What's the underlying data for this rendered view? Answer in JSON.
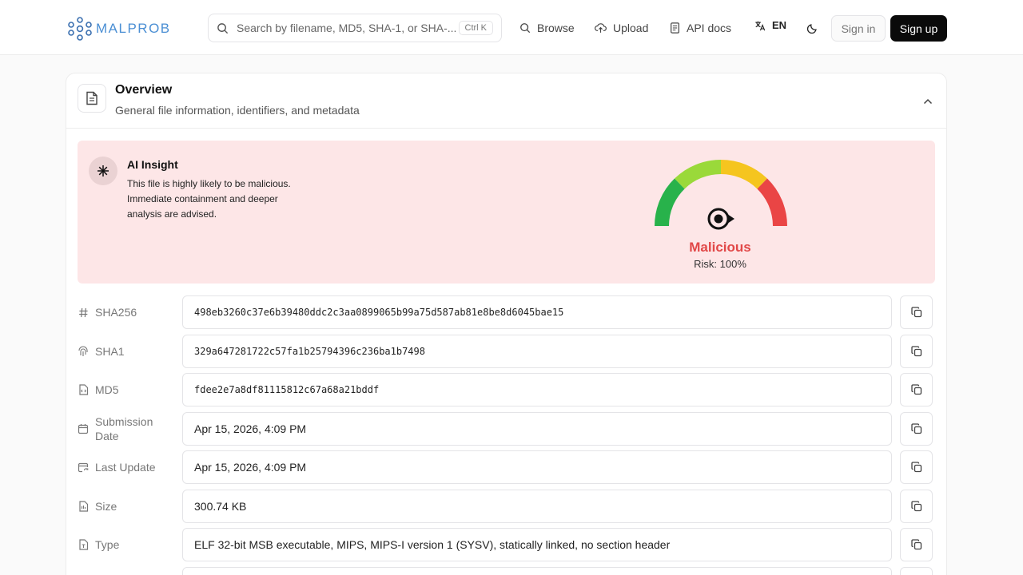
{
  "header": {
    "logo_text": "MALPROB",
    "search": {
      "placeholder": "Search by filename, MD5, SHA-1, or SHA-...",
      "shortcut": "Ctrl K"
    },
    "nav": [
      {
        "label": "Browse",
        "icon": "search-icon"
      },
      {
        "label": "Upload",
        "icon": "cloud-upload-icon"
      },
      {
        "label": "API docs",
        "icon": "document-icon"
      }
    ],
    "language": "EN",
    "sign_in": "Sign in",
    "sign_up": "Sign up"
  },
  "overview": {
    "title": "Overview",
    "subtitle": "General file information, identifiers, and metadata"
  },
  "insight": {
    "title": "AI Insight",
    "text": "This file is highly likely to be malicious. Immediate containment and deeper analysis are advised.",
    "verdict": "Malicious",
    "risk_label": "Risk: 100%",
    "risk_value": 1.0,
    "colors": {
      "verdict": "#e14848",
      "background": "#fde6e7"
    }
  },
  "fields": [
    {
      "label": "SHA256",
      "value": "498eb3260c37e6b39480ddc2c3aa0899065b99a75d587ab81e8be8d6045bae15",
      "mono": true,
      "icon": "hash-icon"
    },
    {
      "label": "SHA1",
      "value": "329a647281722c57fa1b25794396c236ba1b7498",
      "mono": true,
      "icon": "fingerprint-icon"
    },
    {
      "label": "MD5",
      "value": "fdee2e7a8df81115812c67a68a21bddf",
      "mono": true,
      "icon": "file-code-icon"
    },
    {
      "label": "Submission Date",
      "value": "Apr 15, 2026, 4:09 PM",
      "mono": false,
      "icon": "calendar-icon"
    },
    {
      "label": "Last Update",
      "value": "Apr 15, 2026, 4:09 PM",
      "mono": false,
      "icon": "calendar-sync-icon"
    },
    {
      "label": "Size",
      "value": "300.74 KB",
      "mono": false,
      "icon": "file-size-icon"
    },
    {
      "label": "Type",
      "value": "ELF 32-bit MSB executable, MIPS, MIPS-I version 1 (SYSV), statically linked, no section header",
      "mono": false,
      "icon": "file-type-icon"
    }
  ]
}
